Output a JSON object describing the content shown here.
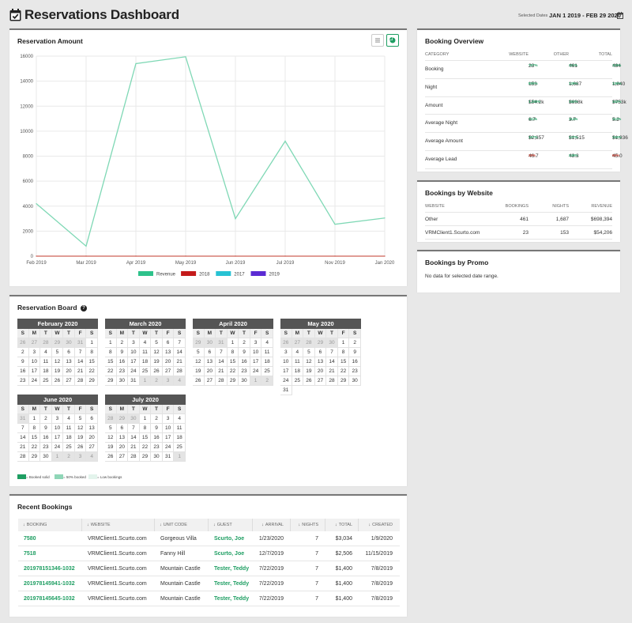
{
  "header": {
    "title": "Reservations Dashboard",
    "selected_label": "Selected Dates",
    "date_range": "JAN 1 2019 - FEB 29 2020"
  },
  "reservation_amount": {
    "title": "Reservation Amount"
  },
  "chart_data": {
    "type": "line",
    "x": [
      "Feb 2019",
      "Mar 2019",
      "Apr 2019",
      "May 2019",
      "Jun 2019",
      "Jul 2019",
      "Nov 2019",
      "Jan 2020"
    ],
    "ylim": [
      0,
      16000
    ],
    "yticks": [
      0,
      2000,
      4000,
      6000,
      8000,
      10000,
      12000,
      14000,
      16000
    ],
    "series": [
      {
        "name": "Revenue",
        "color": "#7fd8b5",
        "values": [
          4200,
          800,
          15400,
          15950,
          3000,
          9200,
          2550,
          3050
        ]
      },
      {
        "name": "2018",
        "color": "#c0392b",
        "values": [
          0,
          0,
          0,
          0,
          0,
          0,
          0,
          0
        ]
      },
      {
        "name": "2017",
        "color": "#27c2d3",
        "values": []
      },
      {
        "name": "2019",
        "color": "#5b2bd3",
        "values": []
      }
    ],
    "legend_swatches": {
      "Revenue": "#2ec28b",
      "2018": "#c41a1a",
      "2017": "#27c2d3",
      "2019": "#5b2bd3"
    },
    "legend_position": "bottom",
    "grid": true
  },
  "booking_overview": {
    "title": "Booking Overview",
    "columns": [
      "CATEGORY",
      "WEBSITE",
      "OTHER",
      "TOTAL"
    ],
    "rows": [
      {
        "category": "Booking",
        "website": "23",
        "website_sub": "767%",
        "other": "461",
        "other_sub": "111%",
        "total": "484",
        "total_sub": "115%"
      },
      {
        "category": "Night",
        "website": "153",
        "website_sub": "850%",
        "other": "1,687",
        "other_sub": "126%",
        "total": "1,840",
        "total_sub": "136%"
      },
      {
        "category": "Amount",
        "website": "$54.2k",
        "website_sub": "1,280%",
        "other": "$698k",
        "other_sub": "152%",
        "total": "$753k",
        "total_sub": "162%"
      },
      {
        "category": "Average Night",
        "website": "6.7",
        "website_sub": "111%",
        "other": "3.7",
        "other_sub": "114%",
        "total": "5.2",
        "total_sub": "112%"
      },
      {
        "category": "Average Amount",
        "website": "$2,357",
        "website_sub": "167%",
        "other": "$1,515",
        "other_sub": "137%",
        "total": "$1,936",
        "total_sub": "154%"
      },
      {
        "category": "Average Lead",
        "website": "46.7",
        "website_sub": "35%",
        "other": "43.3",
        "other_sub": "245%",
        "total": "45.0",
        "total_sub": "66%"
      }
    ]
  },
  "bookings_by_website": {
    "title": "Bookings by Website",
    "columns": [
      "WEBSITE",
      "BOOKINGS",
      "NIGHTS",
      "REVENUE"
    ],
    "rows": [
      {
        "website": "Other",
        "bookings": "461",
        "nights": "1,687",
        "revenue": "$698,394"
      },
      {
        "website": "VRMClient1.Scurto.com",
        "bookings": "23",
        "nights": "153",
        "revenue": "$54,206"
      }
    ]
  },
  "bookings_by_promo": {
    "title": "Bookings by Promo",
    "empty": "No data for selected date range."
  },
  "reservation_board": {
    "title": "Reservation Board",
    "help_icon": "?",
    "dow": [
      "S",
      "M",
      "T",
      "W",
      "T",
      "F",
      "S"
    ],
    "months": [
      {
        "name": "February 2020",
        "lead": [
          26,
          27,
          28,
          29,
          30,
          31
        ],
        "days": 29,
        "trail": []
      },
      {
        "name": "March 2020",
        "lead": [],
        "days": 31,
        "trail": [
          1,
          2,
          3,
          4
        ]
      },
      {
        "name": "April 2020",
        "lead": [
          29,
          30,
          31
        ],
        "days": 30,
        "trail": [
          1,
          2
        ]
      },
      {
        "name": "May 2020",
        "lead": [
          26,
          27,
          28,
          29,
          30
        ],
        "days": 31,
        "trail": []
      },
      {
        "name": "June 2020",
        "lead": [
          31
        ],
        "days": 30,
        "trail": [
          1,
          2,
          3,
          4
        ]
      },
      {
        "name": "July 2020",
        "lead": [
          28,
          29,
          30
        ],
        "days": 31,
        "trail": [
          1
        ]
      }
    ],
    "legend": [
      {
        "label": "= Booked solid",
        "color": "#1e9e62"
      },
      {
        "label": "= 50% booked",
        "color": "#8fd6b7"
      },
      {
        "label": "= Low bookings",
        "color": "#e3f4ec"
      }
    ]
  },
  "recent_bookings": {
    "title": "Recent Bookings",
    "columns": [
      "BOOKING",
      "WEBSITE",
      "UNIT CODE",
      "GUEST",
      "ARRIVAL",
      "NIGHTS",
      "TOTAL",
      "CREATED"
    ],
    "rows": [
      {
        "booking": "7580",
        "website": "VRMClient1.Scurto.com",
        "unit": "Gorgeous Villa",
        "guest": "Scurto, Joe",
        "arrival": "1/23/2020",
        "nights": "7",
        "total": "$3,034",
        "created": "1/9/2020"
      },
      {
        "booking": "7518",
        "website": "VRMClient1.Scurto.com",
        "unit": "Fanny Hill",
        "guest": "Scurto, Joe",
        "arrival": "12/7/2019",
        "nights": "7",
        "total": "$2,506",
        "created": "11/15/2019"
      },
      {
        "booking": "201978151346-1032",
        "website": "VRMClient1.Scurto.com",
        "unit": "Mountain Castle",
        "guest": "Tester, Teddy",
        "arrival": "7/22/2019",
        "nights": "7",
        "total": "$1,400",
        "created": "7/8/2019"
      },
      {
        "booking": "201978145941-1032",
        "website": "VRMClient1.Scurto.com",
        "unit": "Mountain Castle",
        "guest": "Tester, Teddy",
        "arrival": "7/22/2019",
        "nights": "7",
        "total": "$1,400",
        "created": "7/8/2019"
      },
      {
        "booking": "201978145645-1032",
        "website": "VRMClient1.Scurto.com",
        "unit": "Mountain Castle",
        "guest": "Tester, Teddy",
        "arrival": "7/22/2019",
        "nights": "7",
        "total": "$1,400",
        "created": "7/8/2019"
      }
    ]
  }
}
